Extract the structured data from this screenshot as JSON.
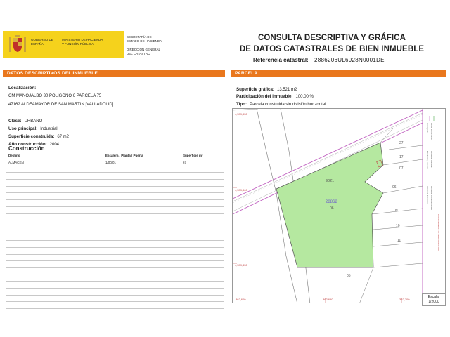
{
  "header": {
    "gov_line1": "GOBIERNO DE ESPAÑA",
    "gov_line2": "MINISTERIO DE HACIENDA Y FUNCIÓN PÚBLICA",
    "gov_line3": "SECRETARÍA DE ESTADO DE HACIENDA",
    "gov_line4": "DIRECCIÓN GENERAL DEL CATASTRO",
    "title_line1": "CONSULTA DESCRIPTIVA Y GRÁFICA",
    "title_line2": "DE DATOS CATASTRALES DE BIEN INMUEBLE",
    "ref_label": "Referencia catastral:",
    "ref_value": "2886206UL6928N0001DE",
    "colors": {
      "gov_yellow": "#f5d21c",
      "bar_orange": "#e9771d"
    }
  },
  "left": {
    "bar_title": "DATOS DESCRIPTIVOS DEL INMUEBLE",
    "loc_label": "Localización:",
    "loc_line1": "CM MANOJALBO 30 POLIGONO 6 PARCELA 75",
    "loc_line2": "47162 ALDEAMAYOR DE SAN MARTIN [VALLADOLID]",
    "clase_label": "Clase:",
    "clase_value": "URBANO",
    "uso_label": "Uso principal:",
    "uso_value": "Industrial",
    "sup_label": "Superficie construida:",
    "sup_value": "67 m2",
    "anio_label": "Año construcción:",
    "anio_value": "2004",
    "construccion_title": "Construcción",
    "table": {
      "headers": [
        "Destino",
        "Escalera / Planta / Puerta",
        "Superficie m²"
      ],
      "rows": [
        [
          "ALMACEN",
          "1/00/01",
          "67"
        ]
      ]
    }
  },
  "right": {
    "bar_title": "PARCELA",
    "sup_label": "Superficie gráfica:",
    "sup_value": "13.521 m2",
    "part_label": "Participación del inmueble:",
    "part_value": "100,00 %",
    "tipo_label": "Tipo:",
    "tipo_value": "Parcela construida sin división horizontal",
    "map": {
      "parcel_number": "28862",
      "parcel_sub": "06",
      "road_label": "9021",
      "lot_labels": [
        "27",
        "17",
        "07",
        "06",
        "09",
        "10",
        "11",
        "05"
      ],
      "y_coords": [
        "4,599,650",
        "4,599,500",
        "4,599,450"
      ],
      "x_coords": [
        "362,600",
        "362,650",
        "362,700"
      ],
      "legend_lines": [
        "Límite de Manzana",
        "Límite de Parcela",
        "Límite de Construcciones",
        "Mobiliario y aceras",
        "Límite zona verde",
        "Hidrografía"
      ],
      "copyright_text": "Coordenadas U.T.M. Huso 30 ETRS89",
      "colors": {
        "parcel_fill": "#b5e8a0",
        "road_line": "#c060c0",
        "coord_text": "#c04040"
      }
    },
    "scale_label": "Escala:",
    "scale_value": "1/2000"
  }
}
